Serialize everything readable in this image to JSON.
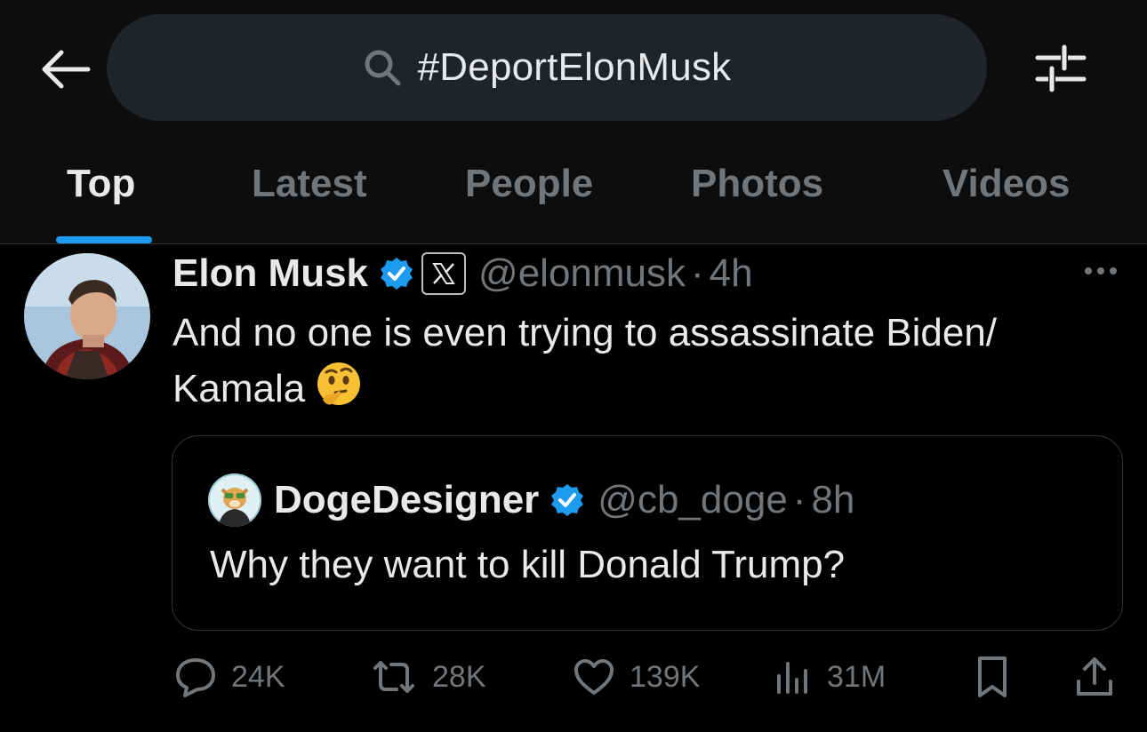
{
  "search": {
    "query": "#DeportElonMusk"
  },
  "tabs": [
    {
      "label": "Top",
      "active": true
    },
    {
      "label": "Latest",
      "active": false
    },
    {
      "label": "People",
      "active": false
    },
    {
      "label": "Photos",
      "active": false
    },
    {
      "label": "Videos",
      "active": false
    }
  ],
  "tweet": {
    "author_name": "Elon Musk",
    "handle": "@elonmusk",
    "separator": "·",
    "time": "4h",
    "text": "And no one is even trying to assassinate Biden/ Kamala",
    "emoji": "thinking-face-emoji",
    "quoted": {
      "author_name": "DogeDesigner",
      "handle": "@cb_doge",
      "separator": "·",
      "time": "8h",
      "text": "Why they want to kill Donald Trump?"
    },
    "actions": {
      "replies": "24K",
      "reposts": "28K",
      "likes": "139K",
      "views": "31M"
    }
  },
  "colors": {
    "background": "#000000",
    "header_background": "#0d0d0d",
    "search_background": "#202327",
    "accent": "#1d9bf0",
    "primary_text": "#e7e9ea",
    "secondary_text": "#71767b",
    "divider": "#2f3336"
  },
  "icons": [
    "back-arrow-icon",
    "search-icon",
    "filter-sliders-icon",
    "verified-badge-icon",
    "x-logo-icon",
    "more-icon",
    "reply-icon",
    "repost-icon",
    "like-icon",
    "views-icon",
    "bookmark-icon",
    "share-icon"
  ]
}
